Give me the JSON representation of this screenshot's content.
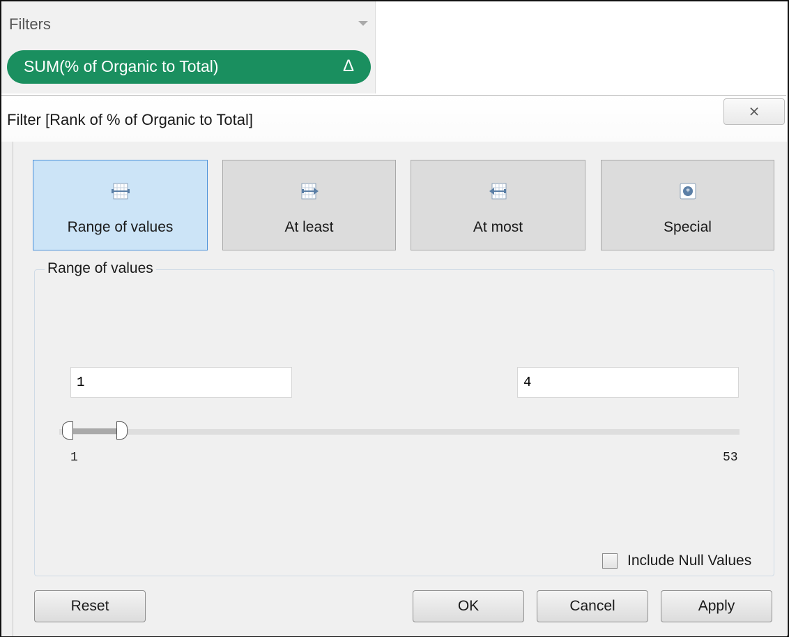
{
  "filters_shelf": {
    "title": "Filters",
    "pill_label": "SUM(% of Organic to Total)",
    "pill_badge": "Δ",
    "pill_color": "#1a8f5f"
  },
  "dialog": {
    "title": "Filter [Rank of % of Organic to Total]",
    "close_glyph": "⨯",
    "modes": [
      {
        "label": "Range of values",
        "icon": "range-icon",
        "active": true
      },
      {
        "label": "At least",
        "icon": "at-least-icon",
        "active": false
      },
      {
        "label": "At most",
        "icon": "at-most-icon",
        "active": false
      },
      {
        "label": "Special",
        "icon": "special-icon",
        "active": false
      }
    ],
    "group_title": "Range of values",
    "min_value": "1",
    "max_value": "4",
    "range_min_label": "1",
    "range_max_label": "53",
    "include_null_label": "Include Null Values",
    "include_null_checked": false,
    "buttons": {
      "reset": "Reset",
      "ok": "OK",
      "cancel": "Cancel",
      "apply": "Apply"
    },
    "active_color": "#cce4f7"
  }
}
